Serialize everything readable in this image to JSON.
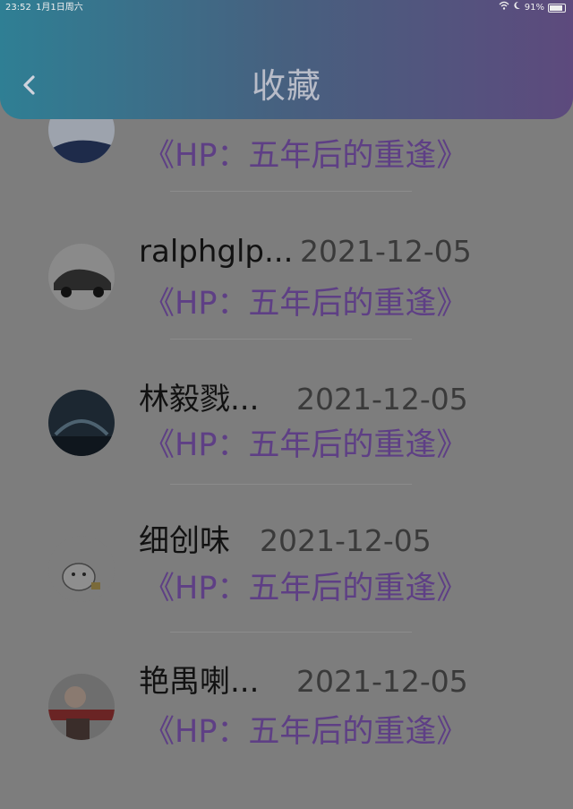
{
  "status_bar": {
    "time": "23:52",
    "date": "1月1日周六",
    "battery": "91%"
  },
  "header": {
    "title": "收藏",
    "back_icon": "chevron-left-icon"
  },
  "colors": {
    "header_start": "#2f7f94",
    "header_end": "#5d4a7d",
    "book_title": "#5e3f85"
  },
  "favorites": [
    {
      "user": "",
      "date": "",
      "book": "《HP：五年后的重逢》"
    },
    {
      "user": "ralphglp...",
      "date": "2021-12-05",
      "book": "《HP：五年后的重逢》"
    },
    {
      "user": "林毅戮...",
      "date": "2021-12-05",
      "book": "《HP：五年后的重逢》"
    },
    {
      "user": "细创味",
      "date": "2021-12-05",
      "book": "《HP：五年后的重逢》"
    },
    {
      "user": "艳禺喇...",
      "date": "2021-12-05",
      "book": "《HP：五年后的重逢》"
    }
  ]
}
